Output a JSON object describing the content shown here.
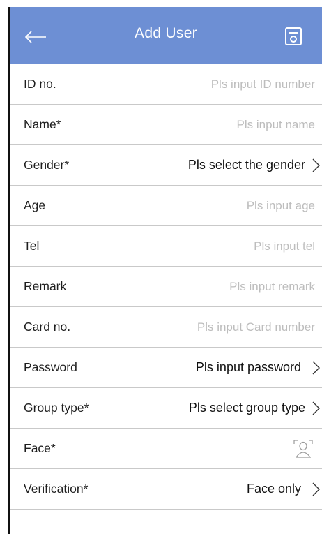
{
  "header": {
    "title": "Add User",
    "back_icon": "arrow-left-icon",
    "save_icon": "floppy-disk-icon",
    "background": "#6d8fd4"
  },
  "fields": [
    {
      "key": "id",
      "label": "ID no.",
      "value": "Pls input ID number",
      "kind": "input"
    },
    {
      "key": "name",
      "label": "Name*",
      "value": "Pls input name",
      "kind": "input"
    },
    {
      "key": "gender",
      "label": "Gender*",
      "value": "Pls select the gender",
      "kind": "select"
    },
    {
      "key": "age",
      "label": "Age",
      "value": "Pls input age",
      "kind": "input"
    },
    {
      "key": "tel",
      "label": "Tel",
      "value": "Pls input tel",
      "kind": "input"
    },
    {
      "key": "remark",
      "label": "Remark",
      "value": "Pls input remark",
      "kind": "input"
    },
    {
      "key": "card",
      "label": "Card no.",
      "value": "Pls input Card number",
      "kind": "input"
    },
    {
      "key": "password",
      "label": "Password",
      "value": "Pls input password",
      "kind": "select"
    },
    {
      "key": "group",
      "label": "Group type*",
      "value": "Pls select group type",
      "kind": "select"
    },
    {
      "key": "face",
      "label": "Face*",
      "value": "",
      "kind": "face"
    },
    {
      "key": "verification",
      "label": "Verification*",
      "value": "Face only",
      "kind": "select"
    }
  ]
}
